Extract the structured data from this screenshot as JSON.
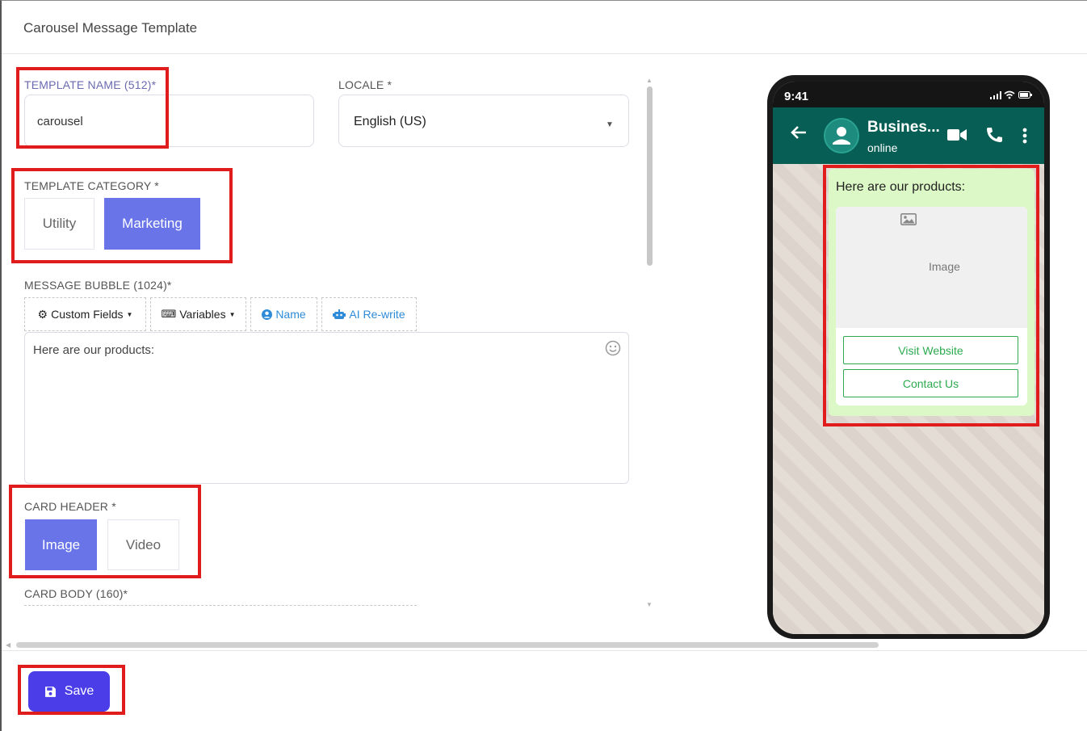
{
  "modal": {
    "title": "Carousel Message Template"
  },
  "template_name": {
    "label": "TEMPLATE NAME (512)*",
    "value": "carousel"
  },
  "locale": {
    "label": "LOCALE *",
    "value": "English (US)"
  },
  "category": {
    "label": "TEMPLATE CATEGORY *",
    "options": [
      "Utility",
      "Marketing"
    ],
    "selected": "Marketing"
  },
  "message_bubble": {
    "label": "MESSAGE BUBBLE (1024)*",
    "toolbar": [
      "Custom Fields",
      "Variables",
      "Name",
      "AI Re-write"
    ],
    "text": "Here are our products:"
  },
  "card_header": {
    "label": "CARD HEADER *",
    "options": [
      "Image",
      "Video"
    ],
    "selected": "Image"
  },
  "card_body": {
    "label": "CARD BODY (160)*"
  },
  "footer": {
    "save_label": "Save"
  },
  "phone": {
    "time": "9:41",
    "contact_name": "Busines...",
    "contact_status": "online",
    "message_text": "Here are our products:",
    "card_image_label": "Image",
    "buttons": [
      "Visit Website",
      "Contact Us"
    ]
  },
  "colors": {
    "accent": "#6874e8",
    "save_button": "#4b3ee8",
    "whatsapp_header": "#075e54",
    "bubble": "#dcf8c6",
    "annotation": "#e01c1c",
    "card_button": "#2daa4f"
  }
}
